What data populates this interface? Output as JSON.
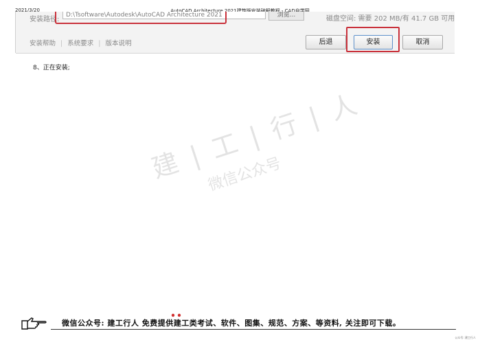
{
  "header": {
    "date": "2021/3/20",
    "title": "AutoCAD Architecture 2021建筑版安装破解教程 - CAD自学网"
  },
  "installer": {
    "path_label": "安装路径:",
    "path_value": "D:\\Tsoftware\\Autodesk\\AutoCAD Architecture 2021",
    "browse_label": "浏览...",
    "space_info": "磁盘空间: 需要 202 MB/有 41.7 GB 可用",
    "links": [
      "安装帮助",
      "系统要求",
      "版本说明"
    ],
    "back_label": "后退",
    "install_label": "安装",
    "cancel_label": "取消"
  },
  "step_text": "8、正在安装;",
  "watermark": {
    "line1": "建 | 工 | 行 | 人",
    "line2": "微信公众号"
  },
  "footer": {
    "text": "微信公众号: 建工行人  免费提供建工类考试、软件、图集、规范、方案、等资料, 关注即可下载。"
  },
  "page_mark": "公众号: 建工行人",
  "colors": {
    "highlight_red": "#c9303a",
    "dialog_bg": "#f3f3f3"
  }
}
